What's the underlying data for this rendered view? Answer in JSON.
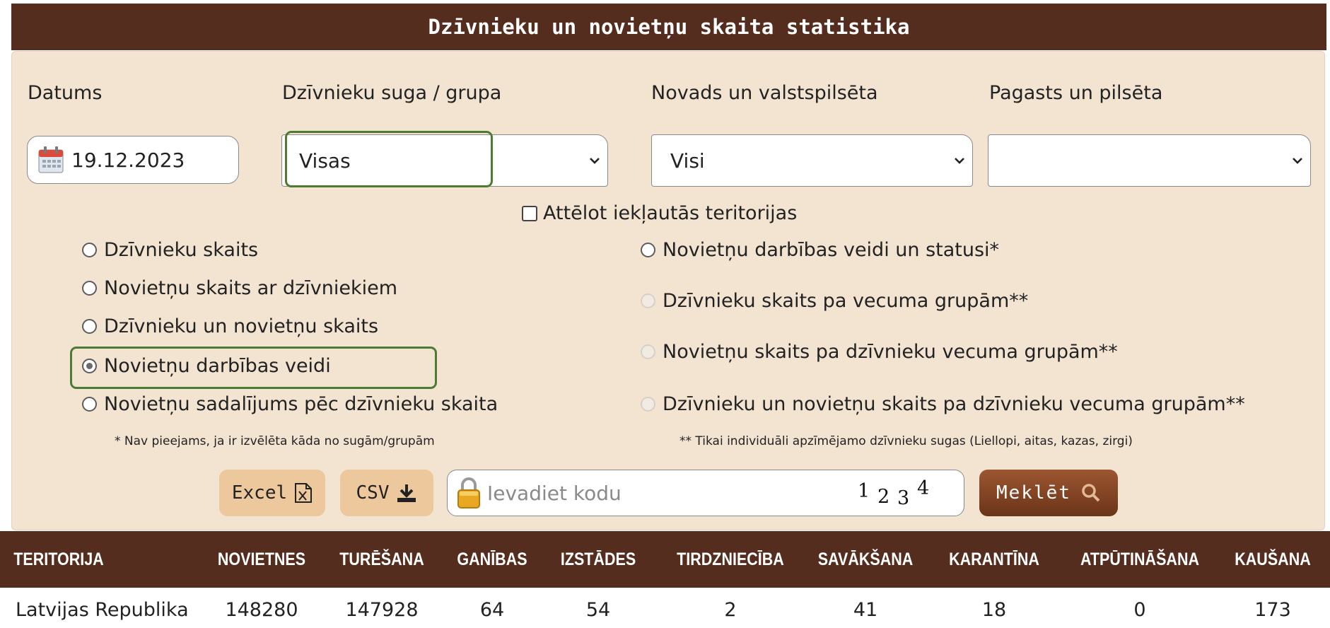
{
  "title": "Dzīvnieku un novietņu skaita statistika",
  "filters": {
    "date_label": "Datums",
    "date_value": "19.12.2023",
    "species_label": "Dzīvnieku suga / grupa",
    "species_value": "Visas",
    "region_label": "Novads un valstspilsēta",
    "region_value": "Visi",
    "parish_label": "Pagasts un pilsēta",
    "parish_value": ""
  },
  "include_territories_label": "Attēlot iekļautās teritorijas",
  "radios_left": [
    {
      "label": "Dzīvnieku skaits",
      "selected": false,
      "disabled": false
    },
    {
      "label": "Novietņu skaits ar dzīvniekiem",
      "selected": false,
      "disabled": false
    },
    {
      "label": "Dzīvnieku un novietņu skaits",
      "selected": false,
      "disabled": false
    },
    {
      "label": "Novietņu darbības veidi",
      "selected": true,
      "disabled": false
    },
    {
      "label": "Novietņu sadalījums pēc dzīvnieku skaita",
      "selected": false,
      "disabled": false
    }
  ],
  "radios_right": [
    {
      "label": "Novietņu darbības veidi un statusi*",
      "selected": false,
      "disabled": false
    },
    {
      "label": "Dzīvnieku skaits pa vecuma grupām**",
      "selected": false,
      "disabled": true
    },
    {
      "label": "Novietņu skaits pa dzīvnieku vecuma grupām**",
      "selected": false,
      "disabled": true
    },
    {
      "label": "Dzīvnieku un novietņu skaits pa dzīvnieku vecuma grupām**",
      "selected": false,
      "disabled": true
    }
  ],
  "notes": {
    "left": "* Nav pieejams, ja ir izvēlēta kāda no sugām/grupām",
    "right": "** Tikai individuāli apzīmējamo dzīvnieku sugas (Liellopi, aitas, kazas, zirgi)"
  },
  "actions": {
    "excel_label": "Excel",
    "csv_label": "CSV",
    "code_placeholder": "Ievadiet kodu",
    "captcha_digits": [
      "1",
      "2",
      "3",
      "4"
    ],
    "search_label": "Meklēt"
  },
  "icons": {
    "date": "calendar-icon",
    "excel": "excel-file-icon",
    "csv": "download-icon",
    "code": "lock-icon",
    "search": "magnifier-icon"
  },
  "colors": {
    "header_brown": "#552d1e",
    "panel_bg": "#f3e4d2",
    "button_tan": "#ecc89c",
    "highlight_green": "#4f7a34"
  },
  "table": {
    "headers": [
      "TERITORIJA",
      "NOVIETNES",
      "TURĒŠANA",
      "GANĪBAS",
      "IZSTĀDES",
      "TIRDZNIECĪBA",
      "SAVĀKŠANA",
      "KARANTĪNA",
      "ATPŪTINĀŠANA",
      "KAUŠANA"
    ],
    "rows": [
      [
        "Latvijas Republika",
        "148280",
        "147928",
        "64",
        "54",
        "2",
        "41",
        "18",
        "0",
        "173"
      ]
    ]
  }
}
